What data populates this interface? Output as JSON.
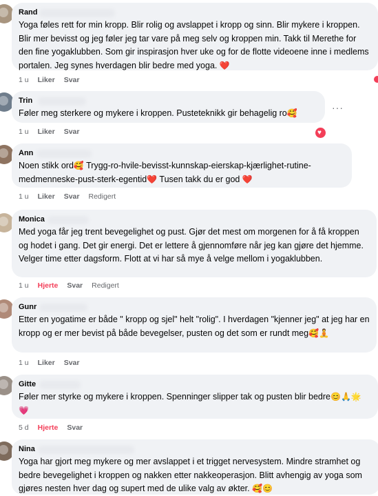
{
  "comments": [
    {
      "name": "Rand",
      "text": "Yoga føles rett for min kropp. Blir rolig og avslappet i kropp og sinn. Blir mykere i kroppen. Blir mer bevisst og jeg føler jeg tar vare på meg selv og kroppen min. Takk til Merethe for den fine yogaklubben. Som gir inspirasjon hver uke og for de flotte videoene inne i medlems portalen. Jeg synes hverdagen blir bedre med yoga.",
      "emoji": "❤️",
      "time": "1 u",
      "like": "Liker",
      "reply": "Svar"
    },
    {
      "name": "Trin",
      "text": "Føler meg sterkere og mykere i kroppen. Pusteteknikk gir behagelig ro",
      "emoji": "🥰",
      "time": "1 u",
      "like": "Liker",
      "reply": "Svar",
      "more": "···"
    },
    {
      "name": "Ann",
      "text_a": "Noen stikk ord",
      "emoji_a": "🥰",
      "text_b": " Trygg-ro-hvile-bevisst-kunnskap-eierskap-kjærlighet-rutine-medmenneske-pust-sterk-egentid",
      "emoji_b": "❤️",
      "text_c": " Tusen takk du er god ",
      "emoji_c": "❤️",
      "time": "1 u",
      "like": "Liker",
      "reply": "Svar",
      "edited": "Redigert"
    },
    {
      "name": "Monica",
      "text": "Med yoga får jeg trent bevegelighet og pust. Gjør det mest om morgenen for å få kroppen og hodet i gang. Det gir energi. Det er lettere å gjennomføre når jeg kan gjøre det hjemme. Velger time etter dagsform. Flott at vi har så mye å velge mellom i yogaklubben.",
      "time": "1 u",
      "like": "Hjerte",
      "reply": "Svar",
      "edited": "Redigert"
    },
    {
      "name": "Gunr",
      "text": "Etter en yogatime er både \" kropp og sjel\" helt \"rolig\". I hverdagen \"kjenner jeg\" at jeg har en kropp og er mer bevist på både bevegelser, pusten og det som er rundt meg",
      "emoji": "🥰🧘",
      "time": "1 u",
      "like": "Liker",
      "reply": "Svar"
    },
    {
      "name": "Gitte",
      "text": "Føler mer styrke og mykere i kroppen. Spenninger slipper tak og pusten blir bedre",
      "emoji": "😊🙏🌟💗",
      "time": "5 d",
      "like": "Hjerte",
      "reply": "Svar"
    },
    {
      "name": "Nina",
      "text": "Yoga har gjort meg mykere og mer avslappet i et trigget nervesystem. Mindre stramhet og bedre bevegelighet i kroppen og nakken etter nakkeoperasjon. Blitt avhengig av yoga som gjøres nesten hver dag og supert med de ulike valg av økter.",
      "emoji": "🥰😊"
    }
  ],
  "colors": {
    "bubble": "#f0f2f5",
    "meta": "#65676b",
    "heart": "#f33e58"
  }
}
